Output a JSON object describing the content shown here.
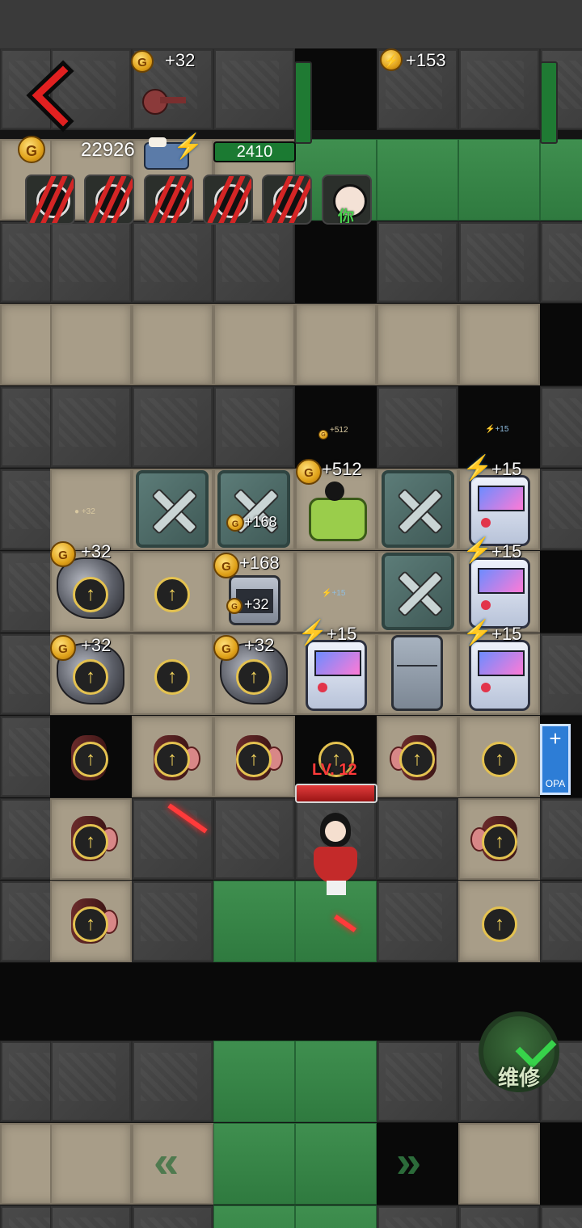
{
  "hud": {
    "back_icon": "back-chevron-icon",
    "gold_total": "22926",
    "energy_value": "2410",
    "top_gold_gain": "+32",
    "top_energy_gain": "+153"
  },
  "avatars": [
    {
      "id": "slot1"
    },
    {
      "id": "slot2"
    },
    {
      "id": "slot3"
    },
    {
      "id": "slot4"
    },
    {
      "id": "slot5"
    },
    {
      "id": "slot6",
      "tag": "你"
    }
  ],
  "floating_labels": {
    "bed_gold": "+512",
    "arcade_energy_1": "+15",
    "arcade_energy_2": "+15",
    "arcade_energy_3": "+15",
    "arcade_energy_4": "+15",
    "toolbox_gold": "+168",
    "oven_gold": "+168",
    "ore_gold_1": "+32",
    "ore_gold_2": "+32",
    "ore_gold_3": "+32",
    "small_gold_1": "+32",
    "small_gold_2": "+32",
    "tiny_gold": "+512",
    "tiny_energy": "+15",
    "tiny_energy_2": "+15",
    "tiny_gold_2": "+32"
  },
  "player": {
    "level_label": "LV. 12",
    "hp_fraction": 0.98
  },
  "buttons": {
    "repair_label": "维修"
  },
  "side_sign": {
    "plus": "+",
    "text": "OPA"
  },
  "colors": {
    "gold": "#e0a21a",
    "energy": "#57b6ff",
    "health_red": "#c42a2a",
    "bar_green": "#1b7a32"
  }
}
